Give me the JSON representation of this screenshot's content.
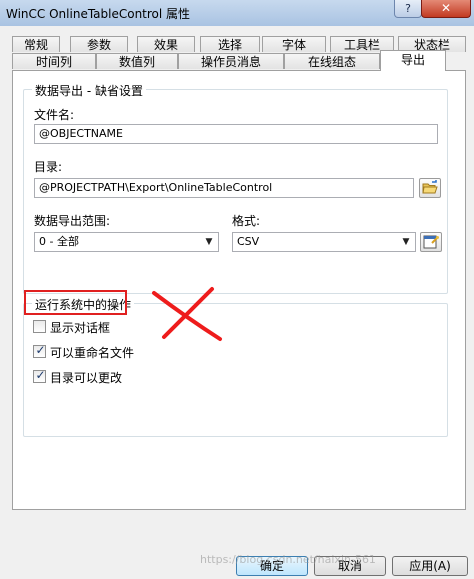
{
  "window": {
    "title": "WinCC OnlineTableControl 属性",
    "help_label": "?",
    "close_label": "✕"
  },
  "tabs": {
    "row1": [
      "常规",
      "参数",
      "效果",
      "选择",
      "字体",
      "工具栏",
      "状态栏"
    ],
    "row2": [
      "时间列",
      "数值列",
      "操作员消息",
      "在线组态",
      "导出"
    ],
    "active": "导出"
  },
  "export_group": {
    "title": "数据导出 - 缺省设置",
    "filename_label": "文件名:",
    "filename_value": "@OBJECTNAME",
    "directory_label": "目录:",
    "directory_value": "@PROJECTPATH\\Export\\OnlineTableControl",
    "range_label": "数据导出范围:",
    "range_value": "0 - 全部",
    "format_label": "格式:",
    "format_value": "CSV"
  },
  "runtime_group": {
    "title": "运行系统中的操作",
    "options": [
      {
        "label": "显示对话框",
        "checked": false
      },
      {
        "label": "可以重命名文件",
        "checked": true
      },
      {
        "label": "目录可以更改",
        "checked": true
      }
    ]
  },
  "buttons": {
    "ok": "确定",
    "cancel": "取消",
    "apply": "应用(A)"
  },
  "watermark": "https://blog.csdn.net/haixin-561"
}
